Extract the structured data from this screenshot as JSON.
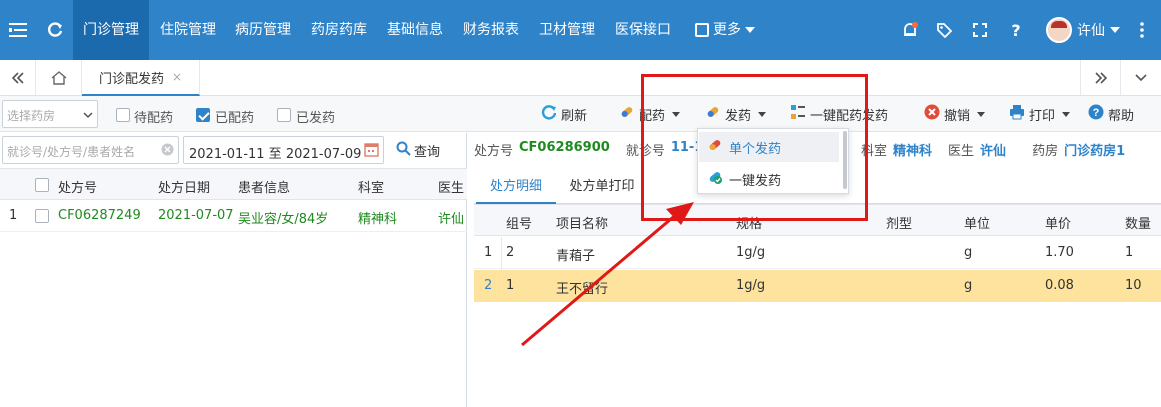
{
  "topnav": {
    "items": [
      "门诊管理",
      "住院管理",
      "病历管理",
      "药房药库",
      "基础信息",
      "财务报表",
      "卫材管理",
      "医保接口"
    ],
    "more_label": "更多",
    "user_name": "许仙"
  },
  "tabs": {
    "active_label": "门诊配发药",
    "close_glyph": "×"
  },
  "toolbar": {
    "pharmacy_placeholder": "选择药房",
    "filter_pending": "待配药",
    "filter_dispensed": "已配药",
    "filter_issued": "已发药",
    "refresh": "刷新",
    "dispense": "配药",
    "issue": "发药",
    "one_click": "一键配药发药",
    "revoke": "撤销",
    "print": "打印",
    "help": "帮助"
  },
  "search": {
    "placeholder": "就诊号/处方号/患者姓名",
    "date_range": "2021-01-11 至 2021-07-09",
    "query": "查询"
  },
  "left_grid": {
    "columns": [
      "处方号",
      "处方日期",
      "患者信息",
      "科室",
      "医生"
    ],
    "rows": [
      {
        "index": "1",
        "rx_no": "CF06287249",
        "date": "2021-07-07",
        "patient": "吴业容/女/84岁",
        "dept": "精神科",
        "doctor": "许仙"
      }
    ]
  },
  "detail_info": {
    "rx_label": "处方号",
    "rx_value": "CF06286900",
    "visit_label": "就诊号",
    "visit_value": "11-11",
    "dept_label": "科室",
    "dept_value": "精神科",
    "doctor_label": "医生",
    "doctor_value": "许仙",
    "pharmacy_label": "药房",
    "pharmacy_value": "门诊药房1"
  },
  "detail_tabs": [
    "处方明细",
    "处方单打印"
  ],
  "detail_grid": {
    "columns": [
      "组号",
      "项目名称",
      "规格",
      "剂型",
      "单位",
      "单价",
      "数量"
    ],
    "rows": [
      {
        "index": "1",
        "group": "2",
        "name": "青葙子",
        "spec": "1g/g",
        "form": "",
        "unit": "g",
        "price": "1.70",
        "qty": "1"
      },
      {
        "index": "2",
        "group": "1",
        "name": "王不留行",
        "spec": "1g/g",
        "form": "",
        "unit": "g",
        "price": "0.08",
        "qty": "10"
      }
    ]
  },
  "dropdown": {
    "single": "单个发药",
    "one_click": "一键发药"
  },
  "colors": {
    "nav_blue": "#2f83c9",
    "nav_active": "#1b6aad",
    "selected_row": "#fde39d",
    "annotation_red": "#e01818"
  }
}
